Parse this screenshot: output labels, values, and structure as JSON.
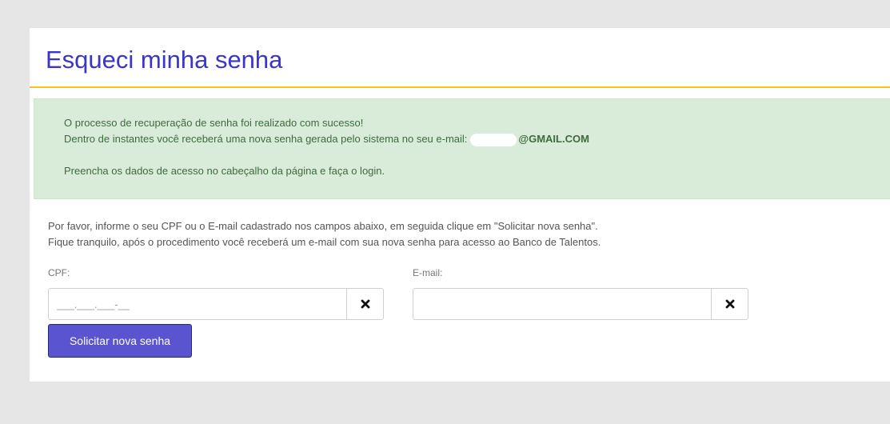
{
  "header": {
    "title": "Esqueci minha senha"
  },
  "alert": {
    "line1": "O processo de recuperação de senha foi realizado com sucesso!",
    "line2_prefix": "Dentro de instantes você receberá uma nova senha gerada pelo sistema no seu e-mail:",
    "email_domain": "@GMAIL.COM",
    "line3": "Preencha os dados de acesso no cabeçalho da página e faça o login."
  },
  "instructions": {
    "line1": "Por favor, informe o seu CPF ou o E-mail cadastrado nos campos abaixo, em seguida clique em \"Solicitar nova senha\".",
    "line2": "Fique tranquilo, após o procedimento você receberá um e-mail com sua nova senha para acesso ao Banco de Talentos."
  },
  "form": {
    "cpf_label": "CPF:",
    "cpf_placeholder": "___.___.___-__",
    "email_label": "E-mail:",
    "email_placeholder": "",
    "submit_label": "Solicitar nova senha"
  },
  "colors": {
    "title": "#3b35c9",
    "header_border": "#f5c518",
    "alert_bg": "#d9ecd9",
    "alert_text": "#3d6b3d",
    "button_bg": "#5b54d0"
  },
  "icons": {
    "clear": "times-icon"
  }
}
